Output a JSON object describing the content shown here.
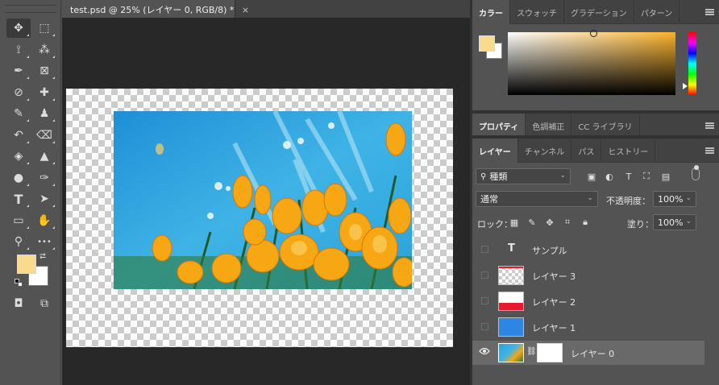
{
  "document": {
    "tab_title": "test.psd @ 25% (レイヤー 0, RGB/8) *",
    "tab_close": "×"
  },
  "toolbar": {
    "tools": [
      {
        "name": "move-tool-icon",
        "glyph": "✥"
      },
      {
        "name": "marquee-tool-icon",
        "glyph": "⬚"
      },
      {
        "name": "lasso-tool-icon",
        "glyph": "⟟"
      },
      {
        "name": "magic-wand-icon",
        "glyph": "⁂"
      },
      {
        "name": "pen-tool-icon",
        "glyph": "✒"
      },
      {
        "name": "frame-tool-icon",
        "glyph": "⊠"
      },
      {
        "name": "eyedropper-icon",
        "glyph": "⊘"
      },
      {
        "name": "healing-brush-icon",
        "glyph": "✚"
      },
      {
        "name": "brush-tool-icon",
        "glyph": "✎"
      },
      {
        "name": "stamp-tool-icon",
        "glyph": "♟"
      },
      {
        "name": "history-brush-icon",
        "glyph": "↶"
      },
      {
        "name": "eraser-tool-icon",
        "glyph": "⌫"
      },
      {
        "name": "paint-bucket-icon",
        "glyph": "◈"
      },
      {
        "name": "blur-tool-icon",
        "glyph": "▲"
      },
      {
        "name": "dodge-tool-icon",
        "glyph": "●"
      },
      {
        "name": "path-pen-icon",
        "glyph": "✑"
      },
      {
        "name": "type-tool-icon",
        "glyph": "T"
      },
      {
        "name": "path-selection-icon",
        "glyph": "➤"
      },
      {
        "name": "rectangle-tool-icon",
        "glyph": "▭"
      },
      {
        "name": "hand-tool-icon",
        "glyph": "✋"
      },
      {
        "name": "zoom-tool-icon",
        "glyph": "⚲"
      },
      {
        "name": "more-tools-icon",
        "glyph": "•••"
      },
      {
        "name": "quick-mask-icon",
        "glyph": "◘"
      },
      {
        "name": "screen-mode-icon",
        "glyph": "⧉"
      }
    ],
    "foreground_color": "#fadb8e",
    "background_color": "#ffffff"
  },
  "color_panel": {
    "tabs": [
      "カラー",
      "スウォッチ",
      "グラデーション",
      "パターン"
    ]
  },
  "properties_panel": {
    "tabs": [
      "プロパティ",
      "色調補正",
      "CC ライブラリ"
    ]
  },
  "layers_panel": {
    "tabs": [
      "レイヤー",
      "チャンネル",
      "パス",
      "ヒストリー"
    ],
    "filter_label": "種類",
    "blend_mode": "通常",
    "opacity_label": "不透明度：",
    "opacity_value": "100%",
    "lock_label": "ロック：",
    "fill_label": "塗り：",
    "fill_value": "100%",
    "layers": [
      {
        "name": "サンプル",
        "type": "text"
      },
      {
        "name": "レイヤー 3",
        "type": "checker-red-line"
      },
      {
        "name": "レイヤー 2",
        "type": "red-white"
      },
      {
        "name": "レイヤー 1",
        "type": "blue"
      },
      {
        "name": "レイヤー 0",
        "type": "photo",
        "selected": true
      }
    ]
  }
}
